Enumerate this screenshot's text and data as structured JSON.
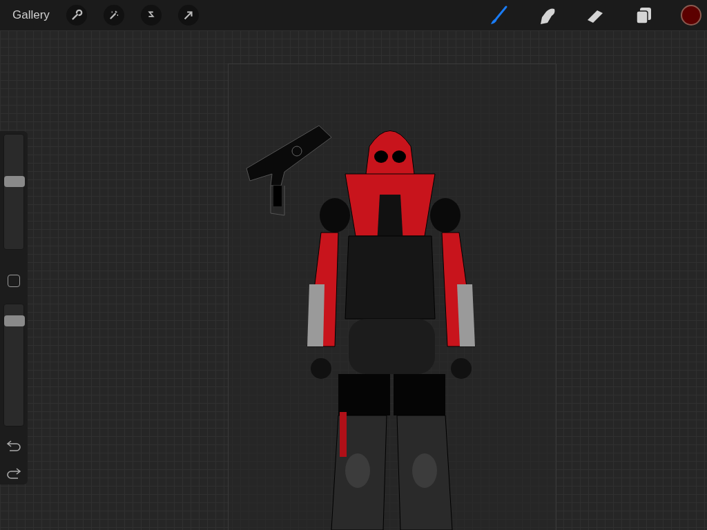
{
  "top_bar": {
    "gallery_label": "Gallery",
    "left_tools": [
      {
        "kind": "wrench"
      },
      {
        "kind": "wand"
      },
      {
        "kind": "selection"
      },
      {
        "kind": "arrow"
      }
    ],
    "right_tools": [
      {
        "kind": "brush",
        "selected": true
      },
      {
        "kind": "smudge",
        "selected": false
      },
      {
        "kind": "eraser",
        "selected": false
      },
      {
        "kind": "layers",
        "selected": false
      }
    ],
    "color_swatch": {
      "color": "#5c0000"
    }
  },
  "sidebar": {
    "brush_size": {
      "level": 0.6
    },
    "opacity": {
      "level": 0.9
    }
  }
}
